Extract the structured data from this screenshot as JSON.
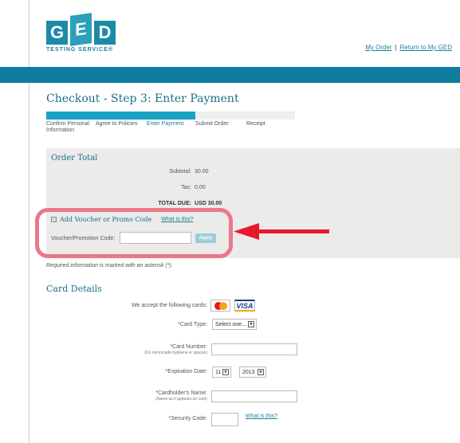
{
  "logo": {
    "letters": [
      "G",
      "E",
      "D"
    ],
    "subtitle": "TESTING SERVICE®",
    "icon": "ged-logo-icon"
  },
  "toplinks": {
    "my_order": "My Order",
    "separator": "|",
    "return": "Return to My GED"
  },
  "page": {
    "title": "Checkout - Step 3: Enter Payment",
    "progress_percent": 60
  },
  "steps": [
    {
      "label": "Confirm Personal Information",
      "active": false
    },
    {
      "label": "Agree to Policies",
      "active": false
    },
    {
      "label": "Enter Payment",
      "active": true
    },
    {
      "label": "Submit Order",
      "active": false
    },
    {
      "label": "Receipt",
      "active": false
    }
  ],
  "order_total": {
    "title": "Order Total",
    "subtotal_label": "Subtotal:",
    "subtotal_value": "30.00",
    "tax_label": "Tax:",
    "tax_value": "0.00",
    "due_label": "TOTAL DUE:",
    "due_value": "USD 30.00"
  },
  "voucher": {
    "checkbox_label": "Add Voucher or Promo Code",
    "what_is_this": "What is this?",
    "field_label": "Voucher/Promotion Code:",
    "field_value": "",
    "apply_label": "Apply"
  },
  "required_note": "Required information is marked with an asterisk (*).",
  "card_details": {
    "title": "Card Details",
    "accept_label": "We accept the following cards:",
    "visa_text": "VISA",
    "mastercard_text": "MasterCard",
    "card_type_label": "*Card Type:",
    "card_type_value": "Select one...",
    "card_number_label": "*Card Number:",
    "card_number_hint": "(Do not include hyphens or spaces)",
    "expiration_label": "*Expiration Date:",
    "exp_month": "11",
    "exp_year": "2013",
    "holder_label": "*Cardholder's Name:",
    "holder_hint": "(Name as it appears on card)",
    "security_label": "*Security Code:",
    "security_what": "What is this?"
  },
  "colors": {
    "brand": "#1c7f9a",
    "bar": "#0e7ea0",
    "highlight": "#e9788a",
    "arrow": "#e8192c"
  }
}
